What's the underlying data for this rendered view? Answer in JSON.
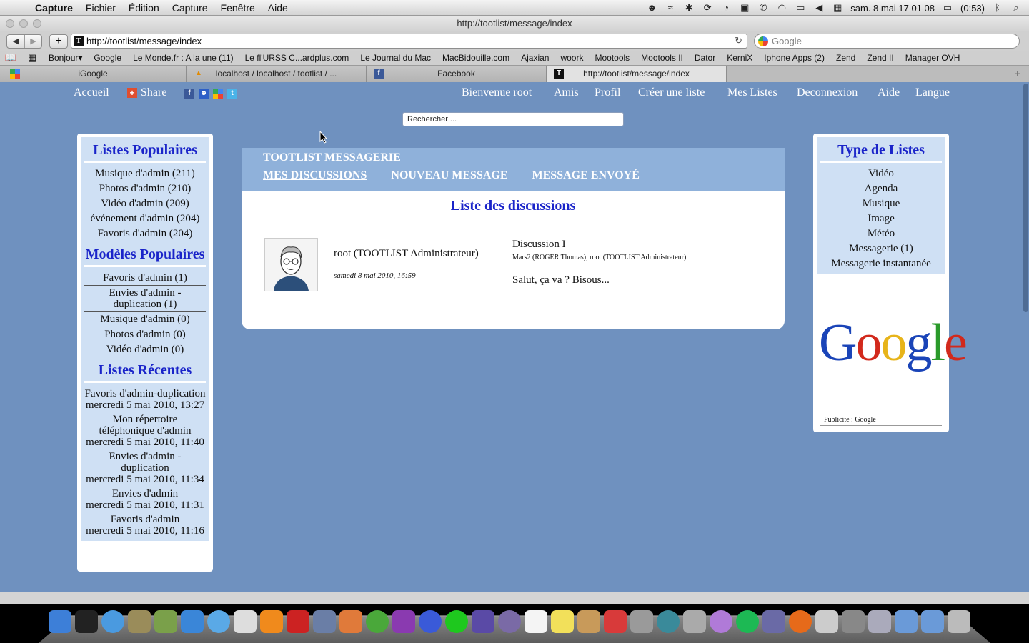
{
  "menubar": {
    "app": "Capture",
    "items": [
      "Fichier",
      "Édition",
      "Capture",
      "Fenêtre",
      "Aide"
    ],
    "clock": "sam. 8 mai  17 01 08",
    "battery": "(0:53)"
  },
  "browser": {
    "window_title": "http://tootlist/message/index",
    "url": "http://tootlist/message/index",
    "search_placeholder": "Google",
    "bookmarks": [
      "Bonjour▾",
      "Google",
      "Le Monde.fr : A la une (11)",
      "Le fl'URSS C...ardplus.com",
      "Le Journal du Mac",
      "MacBidouille.com",
      "Ajaxian",
      "woork",
      "Mootools",
      "Mootools II",
      "Dator",
      "KerniX",
      "Iphone Apps (2)",
      "Zend",
      "Zend II",
      "Manager OVH"
    ],
    "tabs": [
      "iGoogle",
      "localhost / localhost / tootlist / ...",
      "Facebook",
      "http://tootlist/message/index"
    ]
  },
  "topnav": {
    "home": "Accueil",
    "share": "Share",
    "separator": "|",
    "right": [
      "Bienvenue root",
      "Amis",
      "Profil",
      "Créer une liste",
      "Mes Listes",
      "Deconnexion",
      "Aide",
      "Langue"
    ],
    "search_placeholder": "Rechercher ..."
  },
  "left_sidebar": {
    "popular_lists_title": "Listes Populaires",
    "popular_lists": [
      "Musique d'admin (211)",
      "Photos d'admin (210)",
      "Vidéo d'admin (209)",
      "événement d'admin (204)",
      "Favoris d'admin (204)"
    ],
    "popular_models_title": "Modèles Populaires",
    "popular_models": [
      "Favoris d'admin (1)",
      "Envies d'admin - duplication (1)",
      "Musique d'admin (0)",
      "Photos d'admin (0)",
      "Vidéo d'admin (0)"
    ],
    "recent_lists_title": "Listes Récentes",
    "recent_lists": [
      {
        "name": "Favoris d'admin-duplication",
        "date": "mercredi 5 mai 2010, 13:27"
      },
      {
        "name": "Mon répertoire téléphonique d'admin",
        "date": "mercredi 5 mai 2010, 11:40"
      },
      {
        "name": "Envies d'admin - duplication",
        "date": "mercredi 5 mai 2010, 11:34"
      },
      {
        "name": "Envies d'admin",
        "date": "mercredi 5 mai 2010, 11:31"
      },
      {
        "name": "Favoris d'admin",
        "date": "mercredi 5 mai 2010, 11:16"
      }
    ]
  },
  "messaging": {
    "header": "TOOTLIST MESSAGERIE",
    "tabs": [
      "MES DISCUSSIONS",
      "NOUVEAU MESSAGE",
      "MESSAGE ENVOYÉ"
    ],
    "list_title": "Liste des discussions",
    "discussion": {
      "sender": "root (TOOTLIST Administrateur)",
      "date": "samedi 8 mai 2010, 16:59",
      "title": "Discussion I",
      "participants": "Mars2 (ROGER Thomas), root (TOOTLIST Administrateur)",
      "preview": "Salut, ça va ? Bisous..."
    }
  },
  "right_sidebar": {
    "title": "Type de Listes",
    "items": [
      "Vidéo",
      "Agenda",
      "Musique",
      "Image",
      "Météo",
      "Messagerie (1)",
      "Messagerie instantanée"
    ],
    "ad_logo": "Google",
    "ad_caption": "Publicite : Google"
  },
  "colors": {
    "page_bg": "#6f91bf",
    "sidebar_inner": "#cfe0f4",
    "title_blue": "#1a24c9",
    "msg_header": "#8fb1da"
  }
}
